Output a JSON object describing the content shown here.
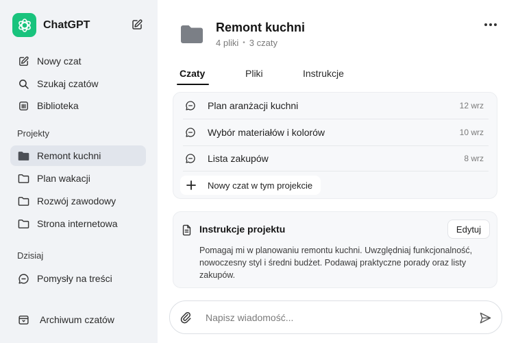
{
  "sidebar": {
    "brand": "ChatGPT",
    "nav": [
      {
        "label": "Nowy czat",
        "icon": "edit-icon"
      },
      {
        "label": "Szukaj czatów",
        "icon": "search-icon"
      },
      {
        "label": "Biblioteka",
        "icon": "library-icon"
      }
    ],
    "projects_label": "Projekty",
    "projects": [
      {
        "label": "Remont kuchni",
        "icon": "folder-filled-icon",
        "active": true
      },
      {
        "label": "Plan wakacji",
        "icon": "folder-icon"
      },
      {
        "label": "Rozwój zawodowy",
        "icon": "folder-icon"
      },
      {
        "label": "Strona internetowa",
        "icon": "folder-icon"
      }
    ],
    "today_label": "Dzisiaj",
    "today": [
      {
        "label": "Pomysły na treści",
        "icon": "chat-bubble-icon"
      }
    ],
    "archive_label": "Archiwum czatów"
  },
  "project": {
    "title": "Remont kuchni",
    "files_count": "4 pliki",
    "chats_count": "3 czaty",
    "separator": "•"
  },
  "tabs": [
    "Czaty",
    "Pliki",
    "Instrukcje"
  ],
  "chats": [
    {
      "title": "Plan aranżacji kuchni",
      "date": "12 wrz"
    },
    {
      "title": "Wybór materiałów i kolorów",
      "date": "10 wrz"
    },
    {
      "title": "Lista zakupów",
      "date": "8 wrz"
    }
  ],
  "new_chat_in_project": "Nowy czat w tym projekcie",
  "instructions": {
    "title": "Instrukcje projektu",
    "edit_label": "Edytuj",
    "text": "Pomagaj mi w planowaniu remontu kuchni. Uwzględniaj funkcjonalność, nowoczesny styl i średni budżet. Podawaj praktyczne porady oraz listy zakupów."
  },
  "composer": {
    "placeholder": "Napisz wiadomość..."
  },
  "colors": {
    "sidebar_bg": "#f1f3f6",
    "active_item": "#e1e5ec",
    "logo_bg": "#19c37d",
    "folder": "#7b7f86"
  }
}
